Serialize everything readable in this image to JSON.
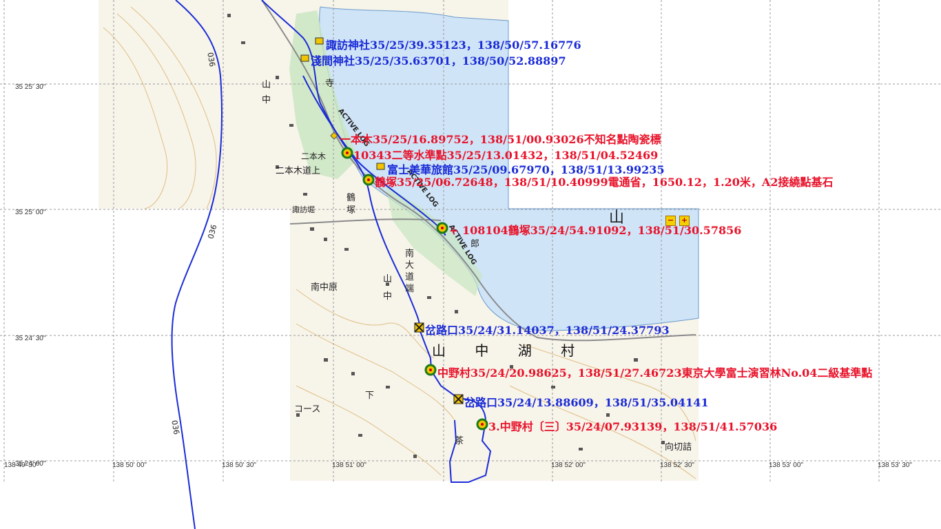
{
  "grid": {
    "lat_labels": [
      "35 25' 30\"",
      "35 25' 00\"",
      "35 24' 30\"",
      "35 24' 00\""
    ],
    "lon_labels": [
      "138 49' 30\"",
      "138 50' 00\"",
      "138 50' 30\"",
      "138 51' 00\"",
      "138 52' 00\"",
      "138 52' 30\"",
      "138 53' 00\"",
      "138 53' 30\""
    ]
  },
  "place_names": {
    "village": "山 中 湖 村",
    "yamanaka_1": "山",
    "yamanaka_2": "中",
    "yamanaka_3": "山",
    "yamanaka_4": "中",
    "nihongi": "二本木",
    "nihongi_michiue": "二本木道上",
    "suwahora": "諏訪堀",
    "tsurutsuka_1": "鶴",
    "tsurutsuka_2": "塚",
    "minami_omichi": "南",
    "minami_omichi_2": "大",
    "minami_omichi_3": "道",
    "minami_omichi_4": "端",
    "minami_nakahara": "南中原",
    "sarugo": "寺",
    "gorosu": "郎",
    "course": "コース",
    "shimoyama": "下",
    "chayaka": "茶",
    "mukaigiri": "向切詰",
    "lake_mark": "山",
    "route_036": "036",
    "active_log": "ACTIVE LOG"
  },
  "annotations": [
    {
      "text": "諏訪神社35/25/39.35123，138/50/57.16776",
      "color": "blue",
      "icon": "shrine-icon"
    },
    {
      "text": "淺間神社35/25/35.63701，138/50/52.88897",
      "color": "blue",
      "icon": "shrine-icon"
    },
    {
      "text": "一本木35/25/16.89752，138/51/00.93026不知名點陶瓷標",
      "color": "red",
      "icon": "diamond-icon"
    },
    {
      "text": "10343二等水準點35/25/13.01432，138/51/04.52469",
      "color": "red",
      "icon": "benchmark-icon"
    },
    {
      "text": "富士美華旅館35/25/09.67970，138/51/13.99235",
      "color": "blue",
      "icon": "hotel-icon"
    },
    {
      "text": "鶴塚35/25/06.72648，138/51/10.40999電通省，1650.12，1.20米，A2接繞點基石",
      "color": "red",
      "icon": "benchmark-icon"
    },
    {
      "text": "+ 108104鶴塚35/24/54.91092，138/51/30.57856",
      "color": "red",
      "icon": "benchmark-icon"
    },
    {
      "text": "岔路口35/24/31.14037，138/51/24.37793",
      "color": "blue",
      "icon": "junction-icon"
    },
    {
      "text": "中野村35/24/20.98625，138/51/27.46723東京大學富士演習林No.04二級基準點",
      "color": "red",
      "icon": "benchmark-icon"
    },
    {
      "text": "岔路口35/24/13.88609，138/51/35.04141",
      "color": "blue",
      "icon": "junction-icon"
    },
    {
      "text": "3.中野村〔三〕35/24/07.93139，138/51/41.57036",
      "color": "red",
      "icon": "benchmark-icon"
    }
  ],
  "zoom": {
    "minus": "−",
    "plus": "+"
  },
  "colors": {
    "lake": "#cfe4f7",
    "route": "#1a2bd6",
    "annotation_blue": "#1a2bd6",
    "annotation_red": "#e8122a",
    "forest": "#c8e6c0",
    "contour": "#d9b26a"
  }
}
